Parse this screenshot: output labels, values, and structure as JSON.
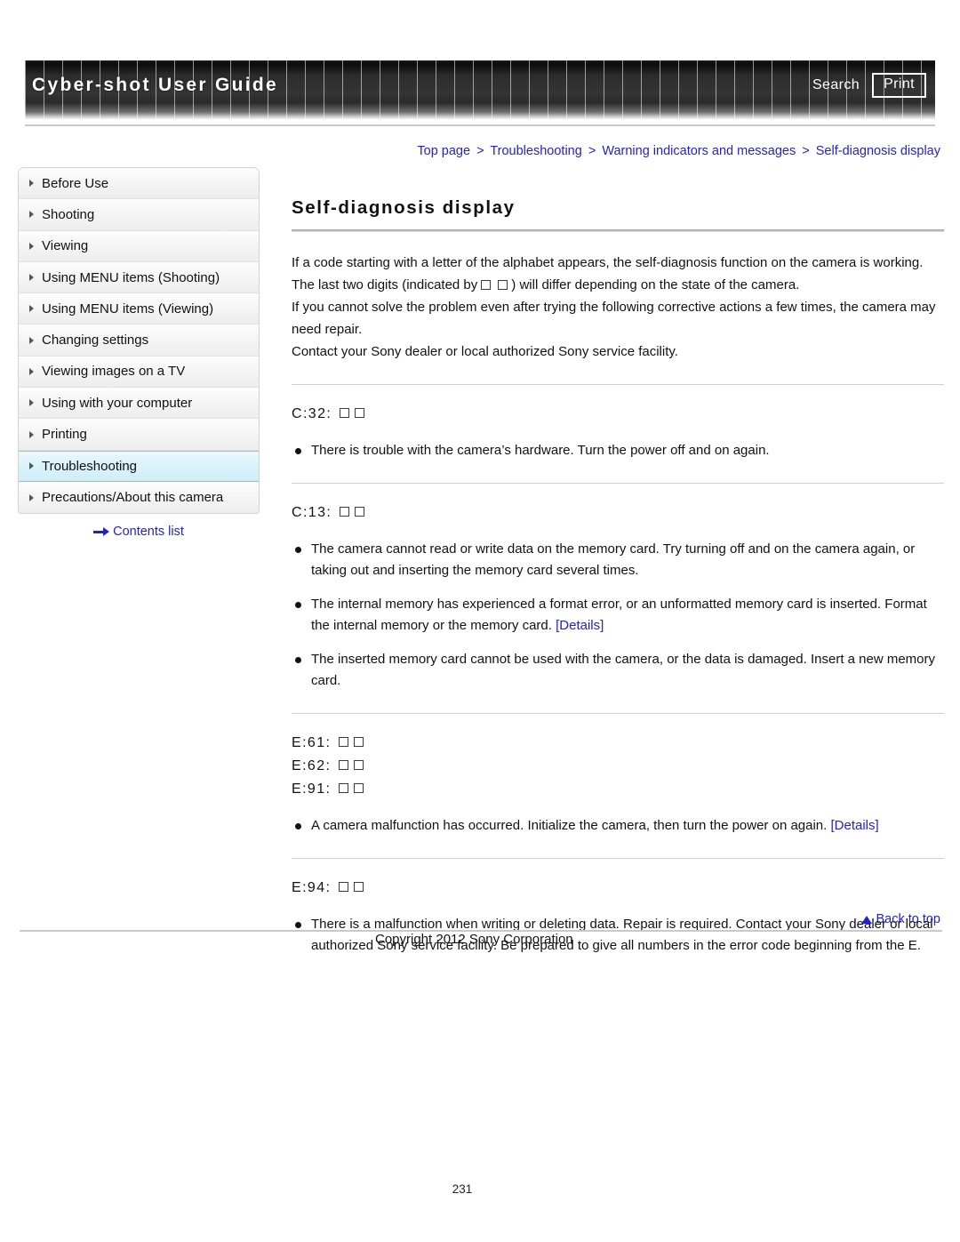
{
  "header": {
    "title": "Cyber-shot User Guide",
    "search_label": "Search",
    "print_label": "Print"
  },
  "breadcrumb": {
    "items": [
      "Top page",
      "Troubleshooting",
      "Warning indicators and messages",
      "Self-diagnosis display"
    ],
    "separator": ">"
  },
  "sidebar": {
    "items": [
      {
        "label": "Before Use",
        "active": false
      },
      {
        "label": "Shooting",
        "active": false
      },
      {
        "label": "Viewing",
        "active": false
      },
      {
        "label": "Using MENU items (Shooting)",
        "active": false
      },
      {
        "label": "Using MENU items (Viewing)",
        "active": false
      },
      {
        "label": "Changing settings",
        "active": false
      },
      {
        "label": "Viewing images on a TV",
        "active": false
      },
      {
        "label": "Using with your computer",
        "active": false
      },
      {
        "label": "Printing",
        "active": false
      },
      {
        "label": "Troubleshooting",
        "active": true
      },
      {
        "label": "Precautions/About this camera",
        "active": false
      }
    ],
    "contents_list_label": "Contents list",
    "contents_list_icon": "arrow-right-icon"
  },
  "main": {
    "title": "Self-diagnosis display",
    "intro": {
      "line1_a": "If a code starting with a letter of the alphabet appears, the self-diagnosis function on the camera is working. The last two digits (indicated by",
      "line1_b": ") will differ depending on the state of the camera.",
      "line2": "If you cannot solve the problem even after trying the following corrective actions a few times, the camera may need repair.",
      "line3": "Contact your Sony dealer or local authorized Sony service facility."
    },
    "sections": [
      {
        "codes": [
          "C:32:"
        ],
        "bullets": [
          {
            "text": "There is trouble with the camera’s hardware. Turn the power off and on again.",
            "link": ""
          }
        ]
      },
      {
        "codes": [
          "C:13:"
        ],
        "bullets": [
          {
            "text": "The camera cannot read or write data on the memory card. Try turning off and on the camera again, or taking out and inserting the memory card several times.",
            "link": ""
          },
          {
            "text": "The internal memory has experienced a format error, or an unformatted memory card is inserted. Format the internal memory or the memory card.",
            "link": "[Details]"
          },
          {
            "text": "The inserted memory card cannot be used with the camera, or the data is damaged. Insert a new memory card.",
            "link": ""
          }
        ]
      },
      {
        "codes": [
          "E:61:",
          "E:62:",
          "E:91:"
        ],
        "bullets": [
          {
            "text": "A camera malfunction has occurred. Initialize the camera, then turn the power on again.",
            "link": "[Details]"
          }
        ]
      },
      {
        "codes": [
          "E:94:"
        ],
        "bullets": [
          {
            "text": "There is a malfunction when writing or deleting data. Repair is required. Contact your Sony dealer or local authorized Sony service facility. Be prepared to give all numbers in the error code beginning from the E.",
            "link": ""
          }
        ]
      }
    ]
  },
  "footer": {
    "back_to_top_label": "Back to top",
    "back_to_top_icon": "triangle-up-icon",
    "copyright": "Copyright 2012 Sony Corporation",
    "page_number": "231"
  },
  "colors": {
    "link": "#2222cc",
    "active_nav": "#cfeef8",
    "active_nav_border": "#6fcfe4",
    "header_dark": "#2c2c2c"
  }
}
